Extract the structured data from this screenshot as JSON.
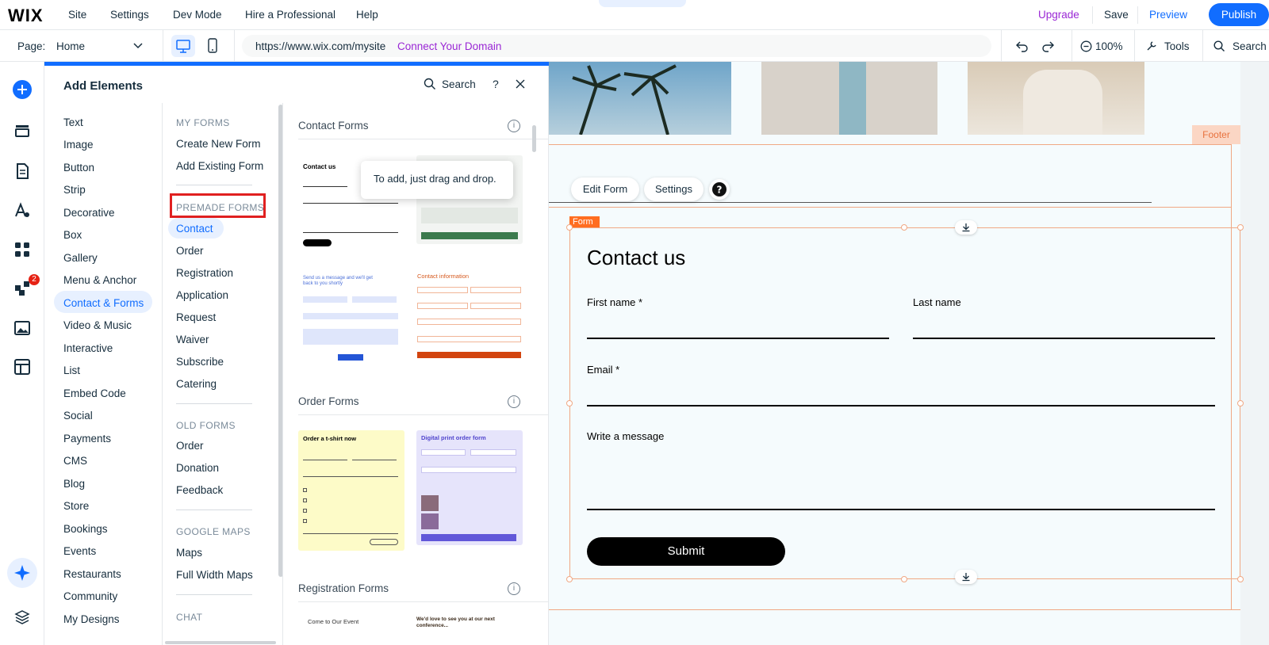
{
  "topbar": {
    "logo": "WIX",
    "menu": [
      "Site",
      "Settings",
      "Dev Mode",
      "Hire a Professional",
      "Help"
    ],
    "upgrade": "Upgrade",
    "save": "Save",
    "preview": "Preview",
    "publish": "Publish"
  },
  "bar2": {
    "page_label": "Page:",
    "page_value": "Home",
    "url": "https://www.wix.com/mysite",
    "connect_domain": "Connect Your Domain",
    "zoom": "100%",
    "tools": "Tools",
    "search": "Search"
  },
  "rail": {
    "badge_count": "2"
  },
  "panel": {
    "title": "Add Elements",
    "search": "Search",
    "help": "?",
    "categories": [
      "Text",
      "Image",
      "Button",
      "Strip",
      "Decorative",
      "Box",
      "Gallery",
      "Menu & Anchor",
      "Contact & Forms",
      "Video & Music",
      "Interactive",
      "List",
      "Embed Code",
      "Social",
      "Payments",
      "CMS",
      "Blog",
      "Store",
      "Bookings",
      "Events",
      "Restaurants",
      "Community",
      "My Designs"
    ],
    "active_category": "Contact & Forms",
    "my_forms_head": "MY FORMS",
    "my_forms": [
      "Create New Form",
      "Add Existing Form"
    ],
    "premade_head": "PREMADE FORMS",
    "premade": [
      "Contact",
      "Order",
      "Registration",
      "Application",
      "Request",
      "Waiver",
      "Subscribe",
      "Catering"
    ],
    "old_head": "OLD FORMS",
    "old": [
      "Order",
      "Donation",
      "Feedback"
    ],
    "maps_head": "GOOGLE MAPS",
    "maps": [
      "Maps",
      "Full Width Maps"
    ],
    "chat_head": "CHAT",
    "sections": [
      "Contact Forms",
      "Order Forms",
      "Registration Forms"
    ],
    "tooltip": "To add, just drag and drop.",
    "thumbs": {
      "contact_title": "Contact us",
      "send_msg_title": "Send us a message and we'll get back to you shortly",
      "contact_info_title": "Contact information",
      "tshirt_title": "Order a t-shirt now",
      "print_title": "Digital print order form",
      "event_title": "Come to Our Event",
      "love_title": "We'd love to see you at our next conference..."
    }
  },
  "canvas": {
    "footer_tag": "Footer",
    "edit_form": "Edit Form",
    "settings": "Settings",
    "form_tag": "Form",
    "form_title": "Contact us",
    "first_name": "First name *",
    "last_name": "Last name",
    "email": "Email *",
    "message": "Write a message",
    "submit": "Submit"
  },
  "colors": {
    "accent": "#116dff",
    "upgrade": "#9a27d5",
    "form_selection": "#ff6d20",
    "highlight_box": "#e02020"
  }
}
